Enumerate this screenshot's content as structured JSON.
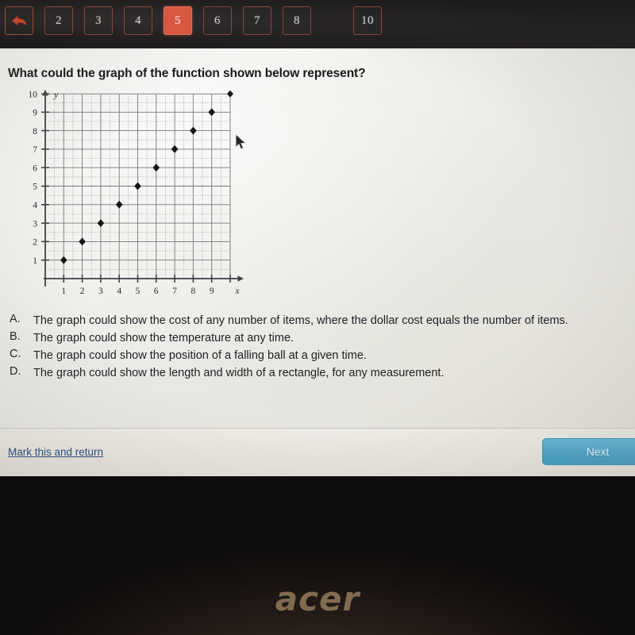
{
  "nav": {
    "back_icon": "back-arrow-icon",
    "buttons": [
      {
        "label": "2",
        "selected": false
      },
      {
        "label": "3",
        "selected": false
      },
      {
        "label": "4",
        "selected": false
      },
      {
        "label": "5",
        "selected": true
      },
      {
        "label": "6",
        "selected": false
      },
      {
        "label": "7",
        "selected": false
      },
      {
        "label": "8",
        "selected": false
      },
      {
        "label": "10",
        "selected": false
      }
    ],
    "selected_value": "5",
    "colors": {
      "bar_background": "#1d1b1b",
      "button_border": "#8d4436",
      "selected_fill": "#d65841",
      "button_text": "#c9ccd2"
    }
  },
  "question": {
    "title": "What could the graph of the function shown below represent?"
  },
  "chart_data": {
    "type": "scatter",
    "title": "",
    "xlabel": "x",
    "ylabel": "y",
    "x": [
      1,
      2,
      3,
      4,
      5,
      6,
      7,
      8,
      9,
      10
    ],
    "y": [
      1,
      2,
      3,
      4,
      5,
      6,
      7,
      8,
      9,
      10
    ],
    "series": [
      {
        "name": "points",
        "points": [
          [
            1,
            1
          ],
          [
            2,
            2
          ],
          [
            3,
            3
          ],
          [
            4,
            4
          ],
          [
            5,
            5
          ],
          [
            6,
            6
          ],
          [
            7,
            7
          ],
          [
            8,
            8
          ],
          [
            9,
            9
          ],
          [
            10,
            10
          ]
        ]
      }
    ],
    "xlim": [
      0,
      10.6
    ],
    "ylim": [
      0,
      10.6
    ],
    "xticks": [
      1,
      2,
      3,
      4,
      5,
      6,
      7,
      8,
      9,
      10
    ],
    "xtick_labels": [
      "1",
      "2",
      "3",
      "4",
      "5",
      "6",
      "7",
      "8",
      "9",
      ""
    ],
    "yticks": [
      1,
      2,
      3,
      4,
      5,
      6,
      7,
      8,
      9,
      10
    ],
    "ytick_labels": [
      "1",
      "2",
      "3",
      "4",
      "5",
      "6",
      "7",
      "8",
      "9",
      "10"
    ],
    "grid": true,
    "grid_minor": true,
    "legend": "none",
    "marker": "diamond",
    "marker_color": "#141414"
  },
  "answers": [
    {
      "letter": "A.",
      "text": "The graph could show the cost of any number of items, where the dollar cost equals the number of items."
    },
    {
      "letter": "B.",
      "text": "The graph could show the temperature at any time."
    },
    {
      "letter": "C.",
      "text": "The graph could show the position of a falling ball at a given time."
    },
    {
      "letter": "D.",
      "text": "The graph could show the length and width of a rectangle, for any measurement."
    }
  ],
  "footer": {
    "mark_return_label": "Mark this and return",
    "next_label": "Next",
    "next_color": "#4aa4c7",
    "link_color": "#2a4a84"
  },
  "device": {
    "brand_logo": "acer"
  }
}
